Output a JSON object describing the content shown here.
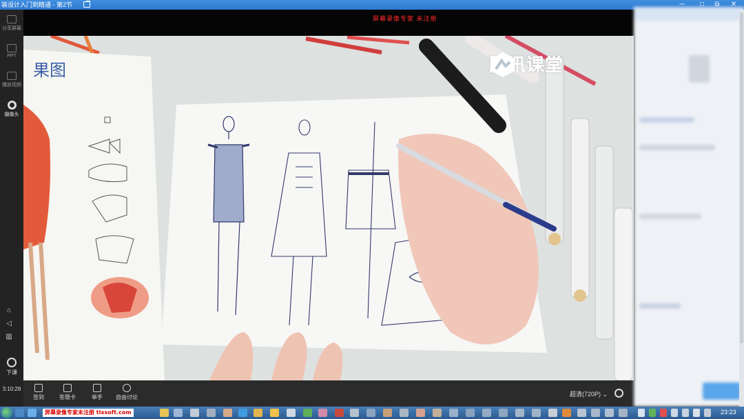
{
  "window": {
    "title": "装设计入门到精通 - 第2节",
    "controls": [
      "─",
      "□",
      "⧉",
      "✕"
    ]
  },
  "recording_watermark": "屏幕录像专家  未注册",
  "brand": {
    "name": "腾讯课堂"
  },
  "left_toolbar": {
    "items": [
      {
        "label": "分享屏幕",
        "icon": "screen-share-icon"
      },
      {
        "label": "PPT",
        "icon": "ppt-icon"
      },
      {
        "label": "播放视频",
        "icon": "play-video-icon"
      },
      {
        "label": "摄像头",
        "icon": "camera-icon",
        "active": true
      }
    ],
    "end_class": "下课",
    "elapsed": "3:10:28"
  },
  "bottom_bar": {
    "buttons": [
      {
        "label": "签到",
        "icon": "checkin-icon"
      },
      {
        "label": "答题卡",
        "icon": "answer-card-icon"
      },
      {
        "label": "举手",
        "icon": "raise-hand-icon"
      },
      {
        "label": "自由讨论",
        "icon": "discussion-mic-icon"
      }
    ],
    "quality": "超清(720P)",
    "quality_chevron": "⌄"
  },
  "taskbar": {
    "ad_text": "屏幕录像专家未注册 tlxsoft.com",
    "time": "23:23"
  },
  "colors": {
    "title_bar": "#2e79d2",
    "watermark_red": "#ff2a2a",
    "toolbar_bg": "#232323",
    "taskbar": "#2b5b92"
  }
}
